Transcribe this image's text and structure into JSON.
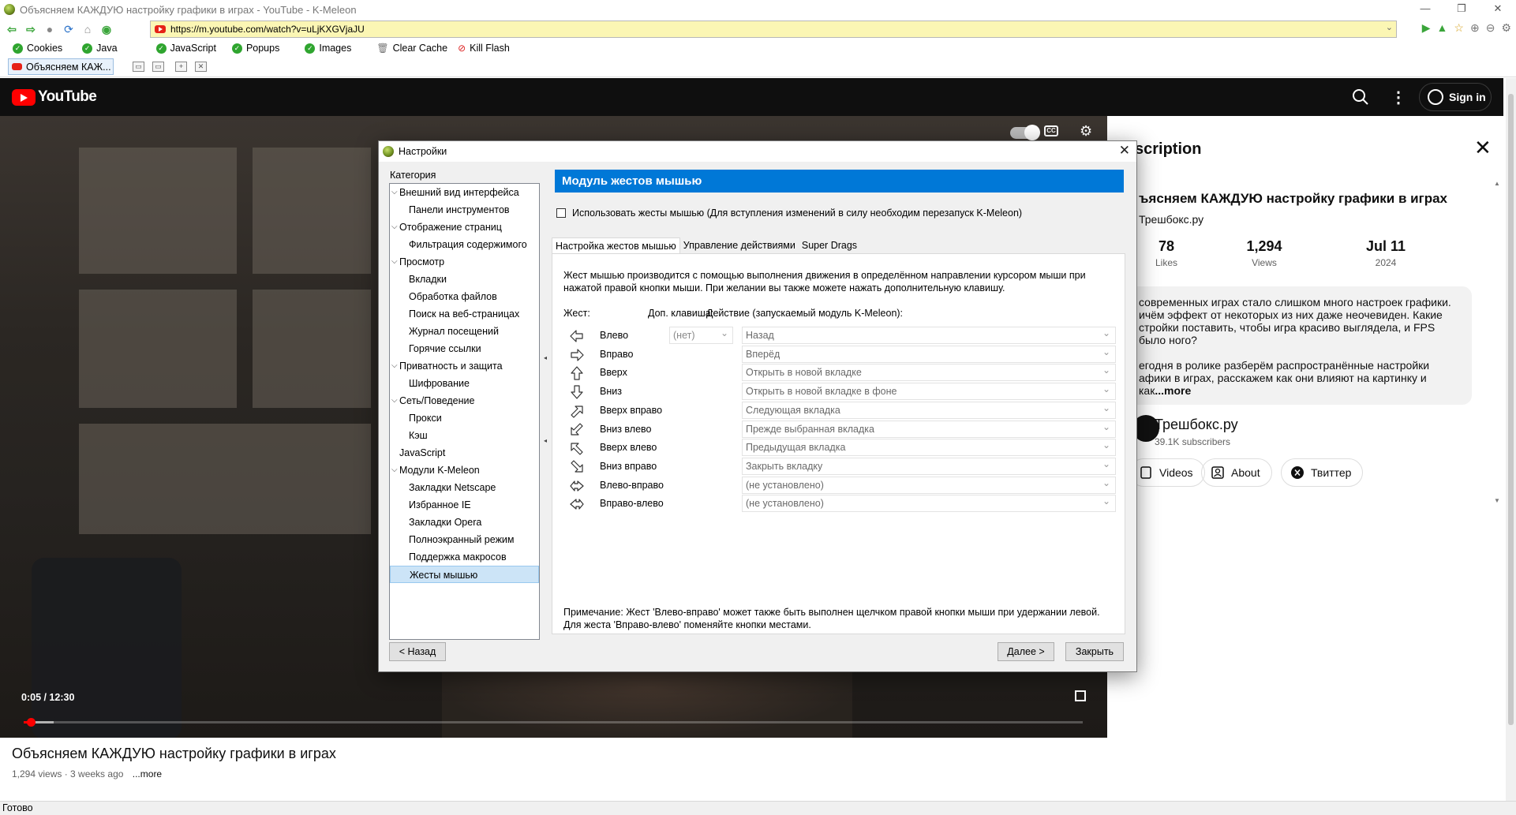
{
  "window": {
    "title": "Объясняем КАЖДУЮ настройку графики в играх - YouTube - K-Meleon",
    "min": "—",
    "max": "❐",
    "close": "✕"
  },
  "navbar": {
    "url": "https://m.youtube.com/watch?v=uLjKXGVjaJU"
  },
  "prefs": {
    "items": [
      {
        "label": "Cookies"
      },
      {
        "label": "Java"
      },
      {
        "label": "JavaScript"
      },
      {
        "label": "Popups"
      },
      {
        "label": "Images"
      }
    ],
    "clear_cache": "Clear Cache",
    "kill_flash": "Kill Flash"
  },
  "tabs": {
    "active_label": "Объясняем КАЖ..."
  },
  "youtube": {
    "logo_text": "YouTube",
    "sign_in": "Sign in",
    "video_time": "0:05 / 12:30",
    "progress_fraction": 0.0067,
    "buffer_fraction": 0.028,
    "video_title": "Объясняем КАЖДУЮ настройку графики в играх",
    "video_meta": "1,294 views · 3 weeks ago",
    "more": "...more"
  },
  "description": {
    "heading": "scription",
    "title": "ъясняем КАЖДУЮ настройку графики в играх",
    "channel_line": "Трешбокс.ру",
    "stats": [
      {
        "value": "78",
        "label": "Likes"
      },
      {
        "value": "1,294",
        "label": "Views"
      },
      {
        "value": "Jul 11",
        "label": "2024"
      }
    ],
    "paragraph1": "современных играх стало слишком много настроек графики. ичём эффект от некоторых из них даже неочевиден. Какие стройки поставить, чтобы игра красиво выглядела, и FPS было ного?",
    "paragraph2": "егодня в ролике разберём распространённые настройки афики в играх, расскажем как они влияют на картинку и как",
    "more": "...more",
    "channel_name": "Трешбокс.ру",
    "channel_subs": "39.1K subscribers",
    "chips": [
      {
        "label": "Videos"
      },
      {
        "label": "About"
      },
      {
        "label": "Твиттер"
      }
    ]
  },
  "statusbar": {
    "text": "Готово"
  },
  "dialog": {
    "title": "Настройки",
    "category_label": "Категория",
    "tree": [
      {
        "label": "Внешний вид интерфейса",
        "level": 0,
        "expanded": true
      },
      {
        "label": "Панели инструментов",
        "level": 1
      },
      {
        "label": "Отображение страниц",
        "level": 0,
        "expanded": true
      },
      {
        "label": "Фильтрация содержимого",
        "level": 1
      },
      {
        "label": "Просмотр",
        "level": 0,
        "expanded": true
      },
      {
        "label": "Вкладки",
        "level": 1
      },
      {
        "label": "Обработка файлов",
        "level": 1
      },
      {
        "label": "Поиск на веб-страницах",
        "level": 1
      },
      {
        "label": "Журнал посещений",
        "level": 1
      },
      {
        "label": "Горячие ссылки",
        "level": 1
      },
      {
        "label": "Приватность и защита",
        "level": 0,
        "expanded": true
      },
      {
        "label": "Шифрование",
        "level": 1
      },
      {
        "label": "Сеть/Поведение",
        "level": 0,
        "expanded": true
      },
      {
        "label": "Прокси",
        "level": 1
      },
      {
        "label": "Кэш",
        "level": 1
      },
      {
        "label": "JavaScript",
        "level": 0
      },
      {
        "label": "Модули K-Meleon",
        "level": 0,
        "expanded": true
      },
      {
        "label": "Закладки Netscape",
        "level": 1
      },
      {
        "label": "Избранное IE",
        "level": 1
      },
      {
        "label": "Закладки Opera",
        "level": 1
      },
      {
        "label": "Полноэкранный режим",
        "level": 1
      },
      {
        "label": "Поддержка макросов",
        "level": 1
      },
      {
        "label": "Жесты мышью",
        "level": 1,
        "selected": true
      }
    ],
    "module_header": "Модуль жестов мышью",
    "enable_checkbox": "Использовать жесты мышью (Для вступления изменений в силу необходим перезапуск K-Meleon)",
    "enable_checked": false,
    "tabs": [
      "Настройка жестов мышью",
      "Управление действиями",
      "Super Drags"
    ],
    "intro": "Жест мышью производится с помощью выполнения движения в определённом направлении курсором мыши при нажатой правой кнопки мыши. При желании вы также можете нажать дополнительную клавишу.",
    "col_gesture": "Жест:",
    "col_modifier": "Доп. клавиша:",
    "col_action": "Действие (запускаемый модуль K-Meleon):",
    "gestures": [
      {
        "name": "Влево",
        "icon": "arrow-left-icon",
        "modifier": "(нет)",
        "action": "Назад"
      },
      {
        "name": "Вправо",
        "icon": "arrow-right-icon",
        "action": "Вперёд"
      },
      {
        "name": "Вверх",
        "icon": "arrow-up-icon",
        "action": "Открыть в новой вкладке"
      },
      {
        "name": "Вниз",
        "icon": "arrow-down-icon",
        "action": "Открыть в новой вкладке в фоне"
      },
      {
        "name": "Вверх вправо",
        "icon": "arrow-up-right-icon",
        "action": "Следующая вкладка"
      },
      {
        "name": "Вниз влево",
        "icon": "arrow-down-left-icon",
        "action": "Прежде выбранная вкладка"
      },
      {
        "name": "Вверх влево",
        "icon": "arrow-up-left-icon",
        "action": "Предыдущая вкладка"
      },
      {
        "name": "Вниз вправо",
        "icon": "arrow-down-right-icon",
        "action": "Закрыть вкладку"
      },
      {
        "name": "Влево-вправо",
        "icon": "arrow-left-right-icon",
        "action": "(не установлено)"
      },
      {
        "name": "Вправо-влево",
        "icon": "arrow-right-left-icon",
        "action": "(не установлено)"
      }
    ],
    "note": "Примечание: Жест 'Влево-вправо' может также быть выполнен щелчком правой кнопки мыши при удержании левой. Для жеста 'Вправо-влево' поменяйте кнопки местами.",
    "back_button": "< Назад",
    "next_button": "Далее >",
    "close_button": "Закрыть"
  }
}
